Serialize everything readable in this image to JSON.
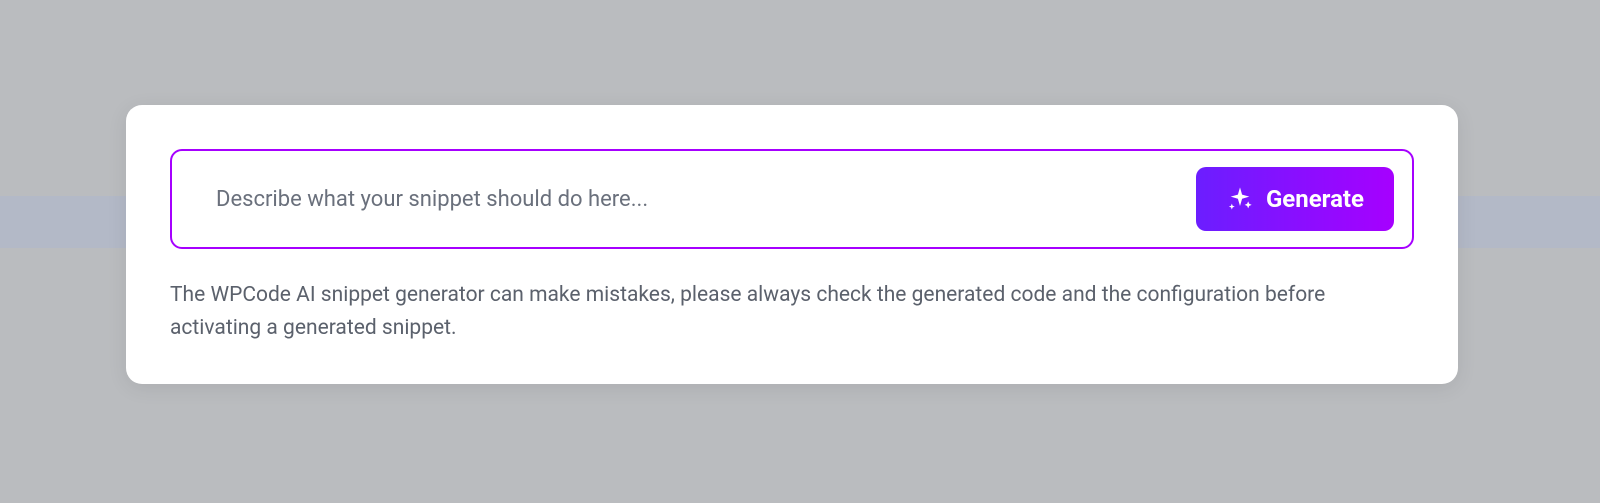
{
  "generator": {
    "input_placeholder": "Describe what your snippet should do here...",
    "button_label": "Generate",
    "disclaimer": "The WPCode AI snippet generator can make mistakes, please always check the generated code and the configuration before activating a generated snippet."
  },
  "colors": {
    "accent": "#a600ff",
    "button_gradient_start": "#6b1eff",
    "button_gradient_end": "#a600ff"
  }
}
